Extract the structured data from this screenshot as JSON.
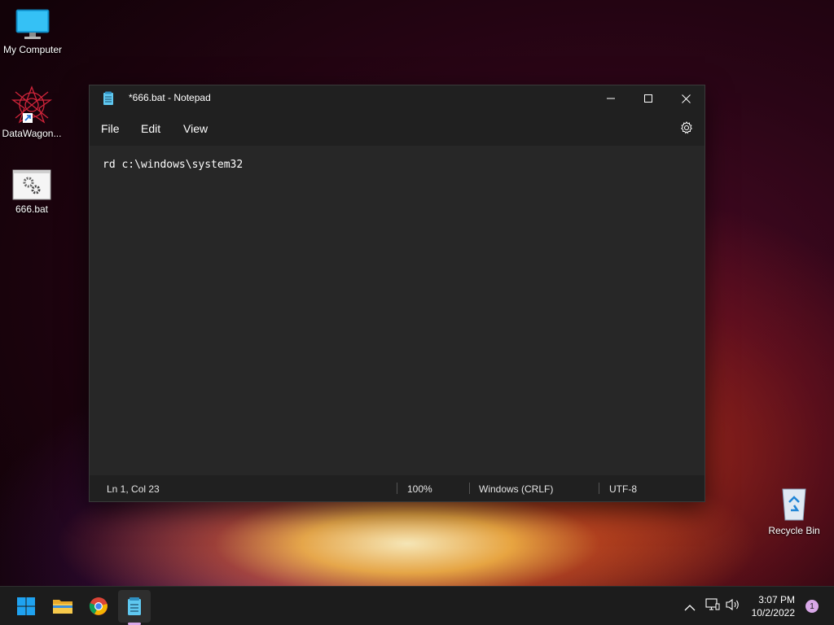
{
  "desktop": {
    "icons": [
      {
        "label": "My Computer"
      },
      {
        "label": "DataWagon..."
      },
      {
        "label": "666.bat"
      },
      {
        "label": "Recycle Bin"
      }
    ]
  },
  "window": {
    "title": "*666.bat - Notepad",
    "menu": {
      "file": "File",
      "edit": "Edit",
      "view": "View"
    },
    "content": "rd c:\\windows\\system32",
    "status": {
      "position": "Ln 1, Col 23",
      "zoom": "100%",
      "line_ending": "Windows (CRLF)",
      "encoding": "UTF-8"
    }
  },
  "taskbar": {
    "time": "3:07 PM",
    "date": "10/2/2022",
    "notifications": "1",
    "apps": [
      "windows-start-icon",
      "file-explorer-icon",
      "chrome-icon",
      "notepad-icon"
    ]
  },
  "colors": {
    "window_bg": "#272727",
    "titlebar_bg": "#202020",
    "taskbar_bg": "#1c1c1c",
    "accent": "#d9a8e8"
  }
}
